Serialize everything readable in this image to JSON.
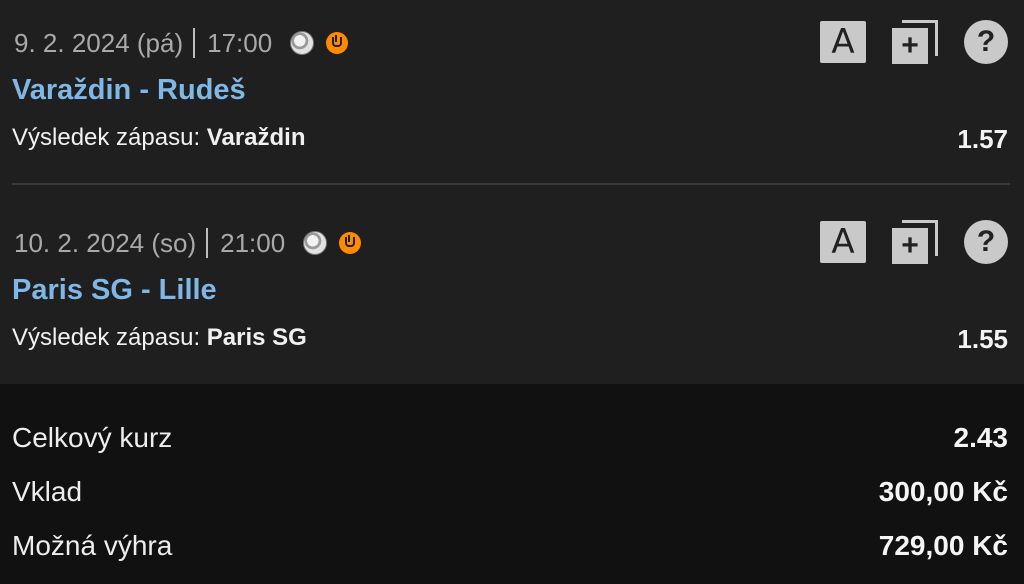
{
  "bets": [
    {
      "date": "9. 2. 2024 (pá)",
      "time": "17:00",
      "match": "Varaždin - Rudeš",
      "market_label": "Výsledek zápasu:",
      "pick": "Varaždin",
      "odds": "1.57",
      "icons": [
        "soccer-ball-icon",
        "live-stream-icon",
        "a-letter-icon",
        "copy-add-icon",
        "help-icon"
      ]
    },
    {
      "date": "10. 2. 2024 (so)",
      "time": "21:00",
      "match": "Paris SG - Lille",
      "market_label": "Výsledek zápasu:",
      "pick": "Paris SG",
      "odds": "1.55",
      "icons": [
        "soccer-ball-icon",
        "live-stream-icon",
        "a-letter-icon",
        "copy-add-icon",
        "help-icon"
      ]
    }
  ],
  "icon_glyphs": {
    "a_letter": "A",
    "copy_plus": "+",
    "help": "?"
  },
  "summary": {
    "total_odds_label": "Celkový kurz",
    "total_odds_value": "2.43",
    "stake_label": "Vklad",
    "stake_value": "300,00 Kč",
    "win_label": "Možná výhra",
    "win_value": "729,00 Kč"
  },
  "colors": {
    "background": "#1f1f1f",
    "summary_background": "#111111",
    "match_link": "#7fb7e6",
    "live_badge": "#ff8a00",
    "icon_gray": "#c9c9c9"
  }
}
